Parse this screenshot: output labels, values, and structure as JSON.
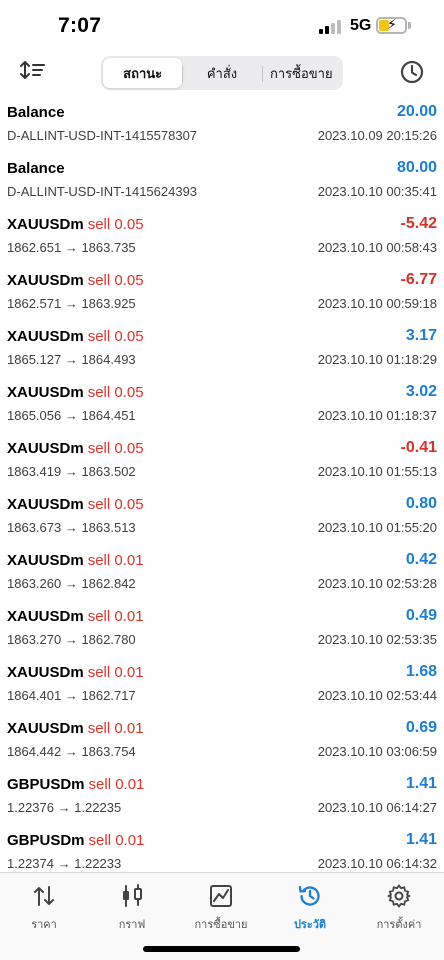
{
  "status_bar": {
    "time": "7:07",
    "network": "5G"
  },
  "toolbar": {
    "segments": [
      {
        "label": "สถานะ",
        "active": true
      },
      {
        "label": "คำสั่ง",
        "active": false
      },
      {
        "label": "การซื้อขาย",
        "active": false
      }
    ]
  },
  "history": [
    {
      "symbol": "Balance",
      "side": "",
      "detail": "D-ALLINT-USD-INT-1415578307",
      "value": "20.00",
      "sign": "pos",
      "time": "2023.10.09 20:15:26"
    },
    {
      "symbol": "Balance",
      "side": "",
      "detail": "D-ALLINT-USD-INT-1415624393",
      "value": "80.00",
      "sign": "pos",
      "time": "2023.10.10 00:35:41"
    },
    {
      "symbol": "XAUUSDm",
      "side": "sell 0.05",
      "detail": "1862.651 → 1863.735",
      "value": "-5.42",
      "sign": "neg",
      "time": "2023.10.10 00:58:43"
    },
    {
      "symbol": "XAUUSDm",
      "side": "sell 0.05",
      "detail": "1862.571 → 1863.925",
      "value": "-6.77",
      "sign": "neg",
      "time": "2023.10.10 00:59:18"
    },
    {
      "symbol": "XAUUSDm",
      "side": "sell 0.05",
      "detail": "1865.127 → 1864.493",
      "value": "3.17",
      "sign": "pos",
      "time": "2023.10.10 01:18:29"
    },
    {
      "symbol": "XAUUSDm",
      "side": "sell 0.05",
      "detail": "1865.056 → 1864.451",
      "value": "3.02",
      "sign": "pos",
      "time": "2023.10.10 01:18:37"
    },
    {
      "symbol": "XAUUSDm",
      "side": "sell 0.05",
      "detail": "1863.419 → 1863.502",
      "value": "-0.41",
      "sign": "neg",
      "time": "2023.10.10 01:55:13"
    },
    {
      "symbol": "XAUUSDm",
      "side": "sell 0.05",
      "detail": "1863.673 → 1863.513",
      "value": "0.80",
      "sign": "pos",
      "time": "2023.10.10 01:55:20"
    },
    {
      "symbol": "XAUUSDm",
      "side": "sell 0.01",
      "detail": "1863.260 → 1862.842",
      "value": "0.42",
      "sign": "pos",
      "time": "2023.10.10 02:53:28"
    },
    {
      "symbol": "XAUUSDm",
      "side": "sell 0.01",
      "detail": "1863.270 → 1862.780",
      "value": "0.49",
      "sign": "pos",
      "time": "2023.10.10 02:53:35"
    },
    {
      "symbol": "XAUUSDm",
      "side": "sell 0.01",
      "detail": "1864.401 → 1862.717",
      "value": "1.68",
      "sign": "pos",
      "time": "2023.10.10 02:53:44"
    },
    {
      "symbol": "XAUUSDm",
      "side": "sell 0.01",
      "detail": "1864.442 → 1863.754",
      "value": "0.69",
      "sign": "pos",
      "time": "2023.10.10 03:06:59"
    },
    {
      "symbol": "GBPUSDm",
      "side": "sell 0.01",
      "detail": "1.22376 → 1.22235",
      "value": "1.41",
      "sign": "pos",
      "time": "2023.10.10 06:14:27"
    },
    {
      "symbol": "GBPUSDm",
      "side": "sell 0.01",
      "detail": "1.22374 → 1.22233",
      "value": "1.41",
      "sign": "pos",
      "time": "2023.10.10 06:14:32"
    }
  ],
  "tabs": [
    {
      "label": "ราคา",
      "icon": "quotes-arrows-icon",
      "active": false
    },
    {
      "label": "กราฟ",
      "icon": "candlestick-chart-icon",
      "active": false
    },
    {
      "label": "การซื้อขาย",
      "icon": "trade-chart-icon",
      "active": false
    },
    {
      "label": "ประวัติ",
      "icon": "history-clock-icon",
      "active": true
    },
    {
      "label": "การตั้งค่า",
      "icon": "gear-icon",
      "active": false
    }
  ],
  "colors": {
    "positive": "#1a7ed8",
    "negative": "#d9302a",
    "sell": "#e0322a",
    "active_tab": "#1a7ed8"
  }
}
